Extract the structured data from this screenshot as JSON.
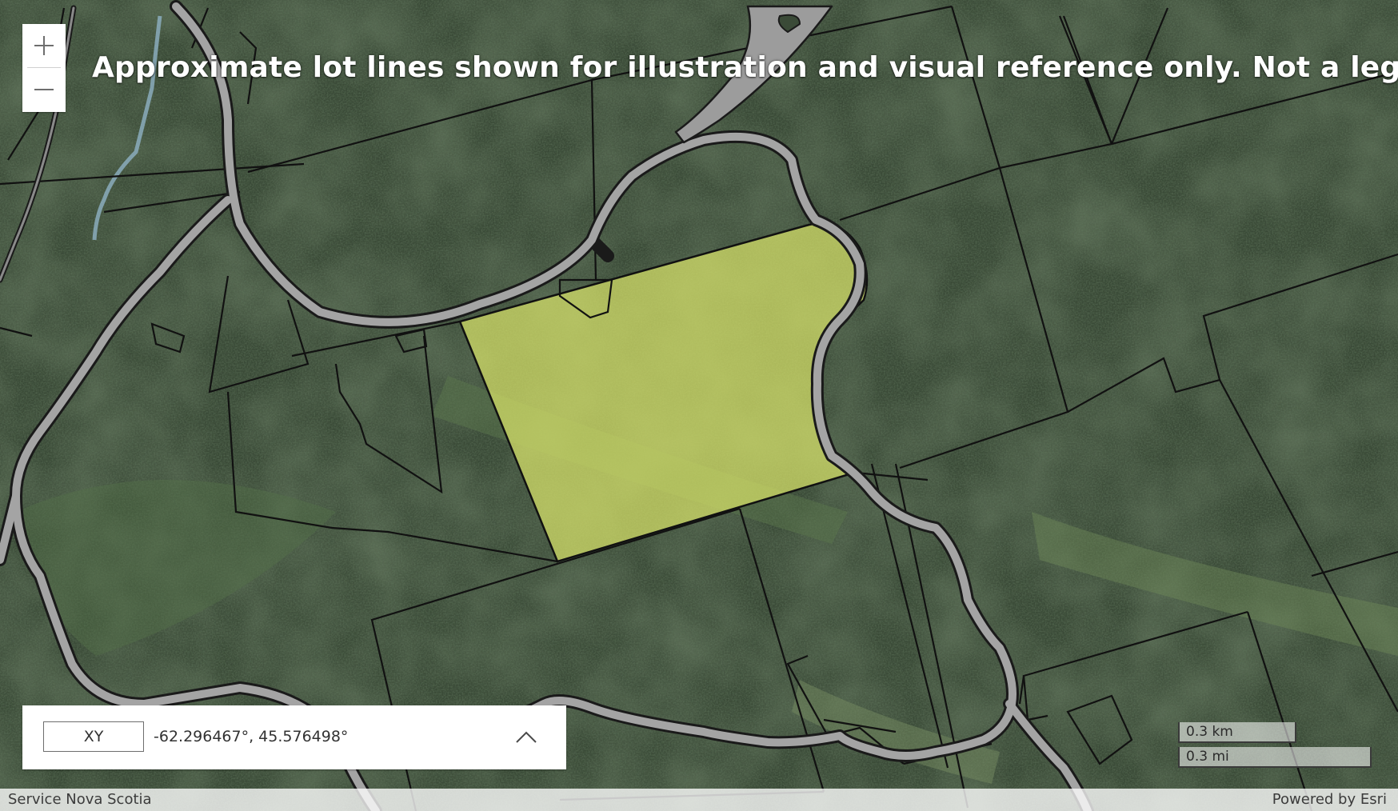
{
  "map": {
    "disclaimer": "Approximate lot lines shown for illustration and visual reference only. Not a legal survey.",
    "highlight_color": "#d8e36a",
    "basemap": "satellite-imagery",
    "road_color": "#9a9a9a",
    "lot_line_color": "#111111"
  },
  "zoom": {
    "zoom_in_icon": "plus-icon",
    "zoom_out_icon": "minus-icon"
  },
  "coordinates": {
    "format_label": "XY",
    "value": "-62.296467°, 45.576498°",
    "toggle_icon": "chevron-up-icon"
  },
  "scale": {
    "km_label": "0.3 km",
    "mi_label": "0.3 mi"
  },
  "attribution": {
    "source": "Service Nova Scotia",
    "powered_by": "Powered by Esri"
  }
}
